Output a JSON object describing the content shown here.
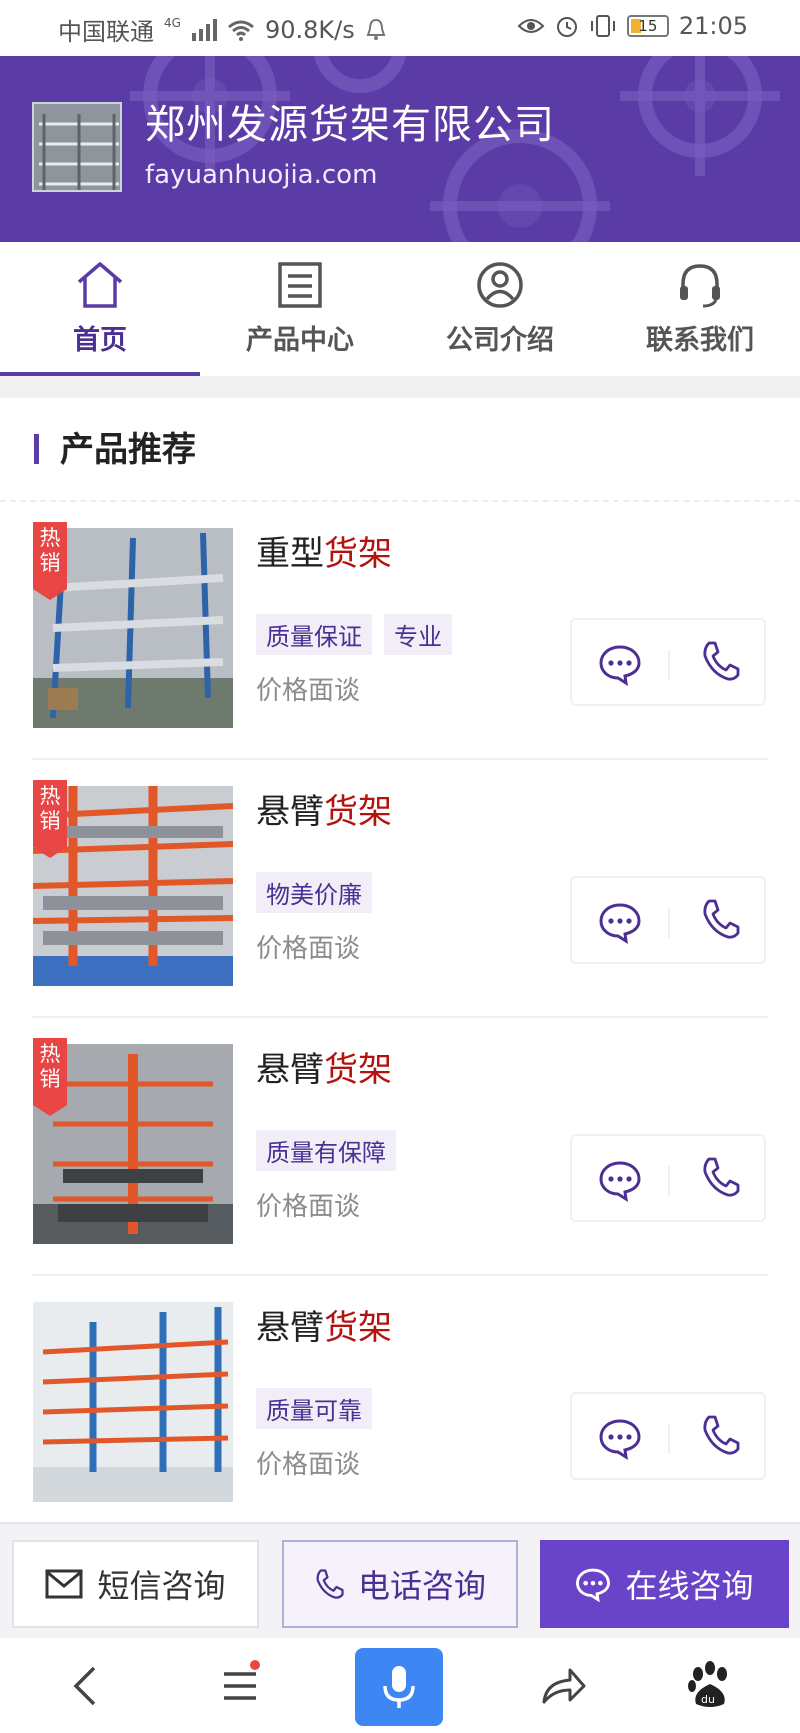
{
  "status_bar": {
    "carrier": "中国联通",
    "network": "4G",
    "speed": "90.8K/s",
    "battery": "15",
    "time": "21:05"
  },
  "header": {
    "company_name": "郑州发源货架有限公司",
    "domain": "fayuanhuojia.com"
  },
  "nav": {
    "items": [
      {
        "label": "首页",
        "icon": "home-icon",
        "active": true
      },
      {
        "label": "产品中心",
        "icon": "list-icon",
        "active": false
      },
      {
        "label": "公司介绍",
        "icon": "user-circle-icon",
        "active": false
      },
      {
        "label": "联系我们",
        "icon": "headset-icon",
        "active": false
      }
    ]
  },
  "section": {
    "title": "产品推荐"
  },
  "products": [
    {
      "name_prefix": "重型",
      "name_accent": "货架",
      "hot": "热销",
      "tags": [
        "质量保证",
        "专业"
      ],
      "price": "价格面谈"
    },
    {
      "name_prefix": "悬臂",
      "name_accent": "货架",
      "hot": "热销",
      "tags": [
        "物美价廉"
      ],
      "price": "价格面谈"
    },
    {
      "name_prefix": "悬臂",
      "name_accent": "货架",
      "hot": "热销",
      "tags": [
        "质量有保障"
      ],
      "price": "价格面谈"
    },
    {
      "name_prefix": "悬臂",
      "name_accent": "货架",
      "hot": "",
      "tags": [
        "质量可靠"
      ],
      "price": "价格面谈"
    }
  ],
  "consult_bar": {
    "sms_label": "短信咨询",
    "tel_label": "电话咨询",
    "online_label": "在线咨询"
  },
  "colors": {
    "brand": "#5b3ca6",
    "accent_red": "#b3130f",
    "hot_badge": "#e84545",
    "online_button": "#6a44c8",
    "mic_button": "#3d86f4"
  }
}
